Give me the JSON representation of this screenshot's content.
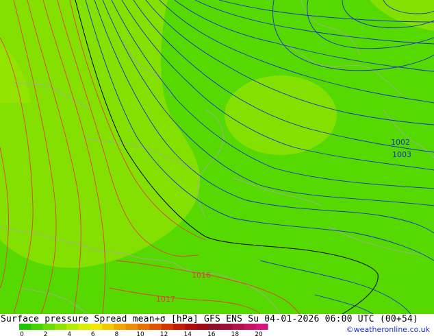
{
  "title": "Surface pressure Spread mean+σ [hPa] GFS ENS  Su 04-01-2026 06:00 UTC (00+54)",
  "credit": "©weatheronline.co.uk",
  "isobar_labels": [
    {
      "text": "1002",
      "color": "#1a2fd0"
    },
    {
      "text": "1003",
      "color": "#1a2fd0"
    },
    {
      "text": "1016",
      "color": "#e0403a"
    },
    {
      "text": "1017",
      "color": "#e0403a"
    }
  ],
  "legend": {
    "ticks": [
      "0",
      "2",
      "4",
      "6",
      "8",
      "10",
      "12",
      "14",
      "16",
      "18",
      "20"
    ],
    "colors": [
      "#21c400",
      "#43d400",
      "#66dc00",
      "#8ee400",
      "#b4ec00",
      "#d8f000",
      "#f4e800",
      "#f4c800",
      "#f0a800",
      "#ec8c00",
      "#e87000",
      "#e05000",
      "#d43400",
      "#c41c00",
      "#b00c0c",
      "#a00818",
      "#900c28",
      "#a00c3c",
      "#b4104c",
      "#c81460",
      "#d8147c"
    ]
  },
  "colors": {
    "field_base": "#55d900",
    "field_mid": "#84e000",
    "field_light": "#a0e800",
    "isobar_high": "#e0403a",
    "isobar_low": "#1a2fd0",
    "isobar_ref": "#000000",
    "coastline": "#a8a8a8"
  }
}
